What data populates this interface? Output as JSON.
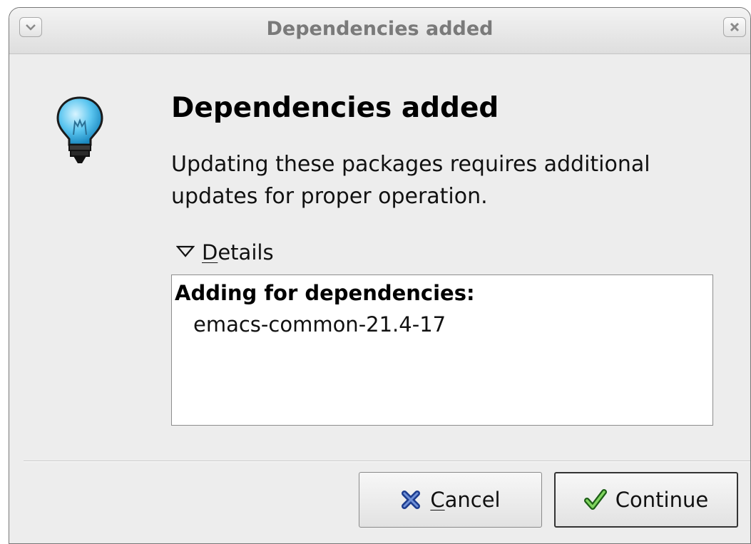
{
  "window": {
    "title": "Dependencies added"
  },
  "dialog": {
    "heading": "Dependencies added",
    "message": "Updating these packages requires additional updates for proper operation.",
    "details": {
      "mnemonic": "D",
      "label_rest": "etails",
      "expanded": true,
      "list_heading": "Adding for dependencies:",
      "items": [
        "emacs-common-21.4-17"
      ]
    }
  },
  "buttons": {
    "cancel": {
      "mnemonic": "C",
      "label_rest": "ancel",
      "icon": "cancel-x-icon"
    },
    "continue": {
      "label": "Continue",
      "icon": "checkmark-icon"
    }
  },
  "icons": {
    "dialog": "lightbulb-icon"
  },
  "colors": {
    "bulb": "#5cc6f0",
    "cancel_icon": "#1e3d8f",
    "check_icon": "#3aa52a"
  }
}
